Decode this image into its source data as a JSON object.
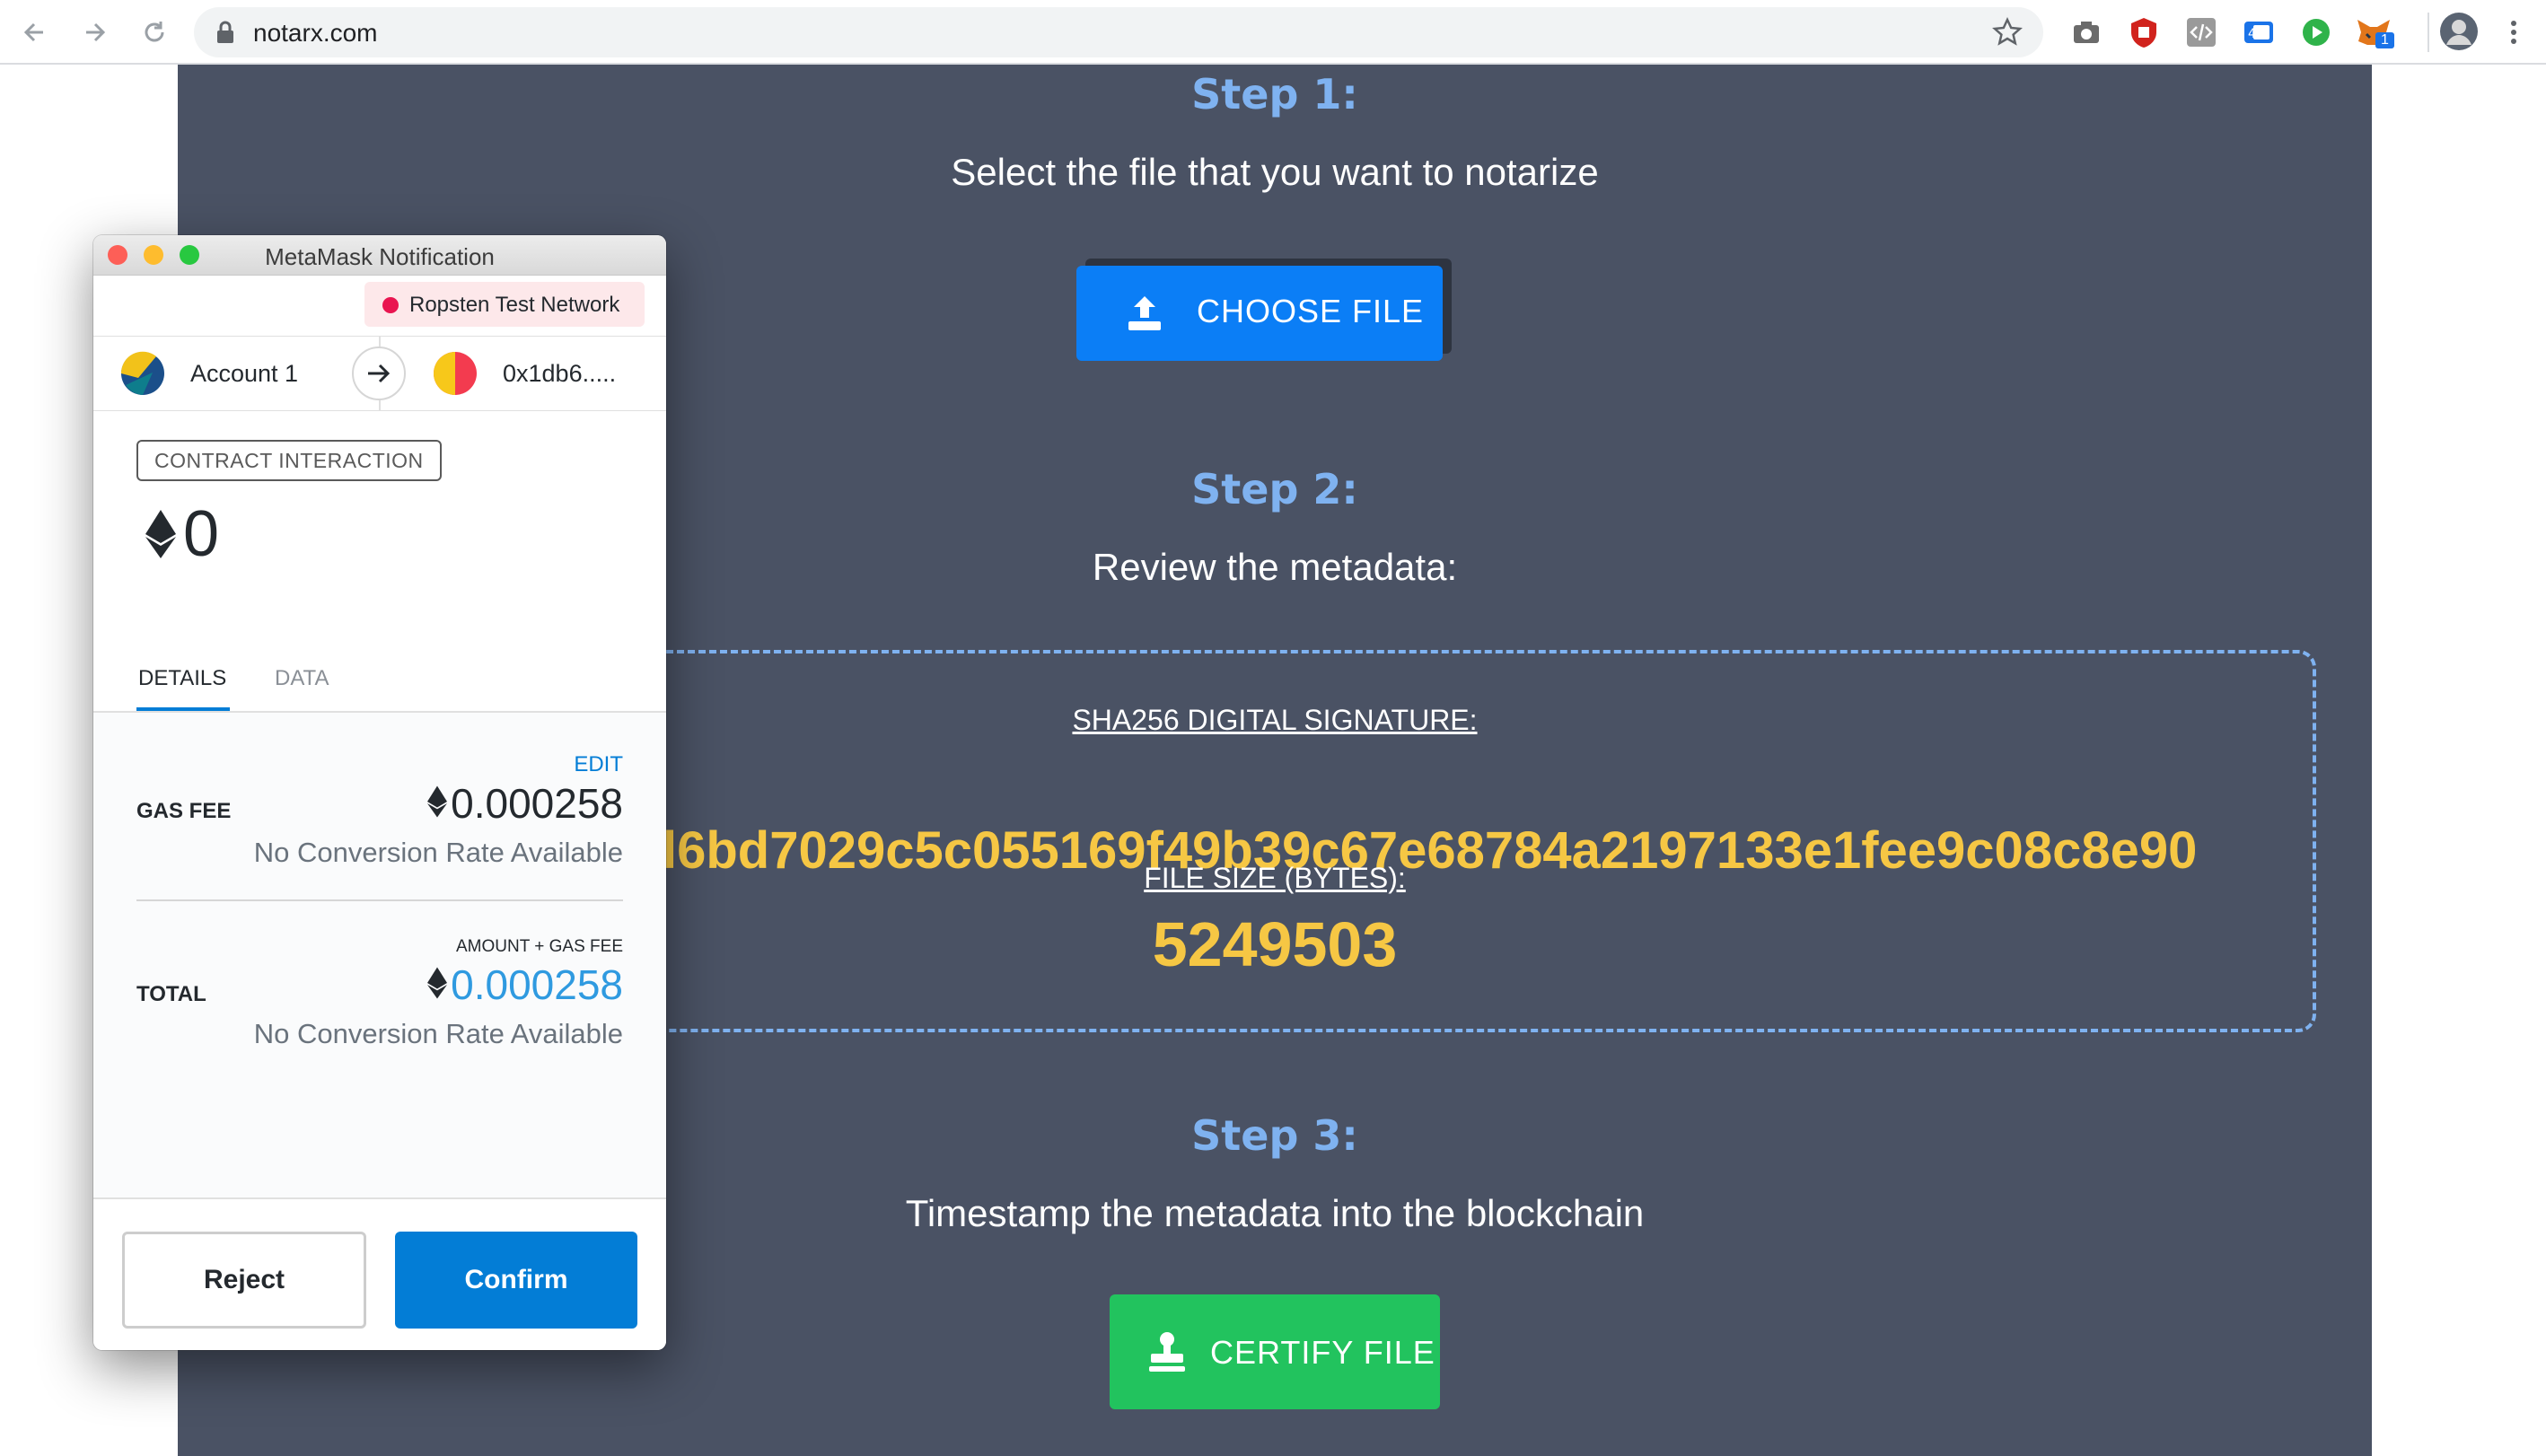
{
  "browser": {
    "url": "notarx.com",
    "extension_badge": "1"
  },
  "page": {
    "step1": {
      "title": "Step 1:",
      "subtitle": "Select the file that you want to notarize",
      "button": "CHOOSE FILE"
    },
    "step2": {
      "title": "Step 2:",
      "subtitle": "Review the metadata:",
      "sha_label": "SHA256 DIGITAL SIGNATURE:",
      "sha_value": "l6bd7029c5c055169f49b39c67e68784a2197133e1fee9c08c8e90",
      "size_label": "FILE SIZE (BYTES):",
      "size_value": "5249503"
    },
    "step3": {
      "title": "Step 3:",
      "subtitle": "Timestamp the metadata into the blockchain",
      "button": "CERTIFY FILE"
    }
  },
  "metamask": {
    "window_title": "MetaMask Notification",
    "network": "Ropsten Test Network",
    "from_account": "Account 1",
    "to_address": "0x1db6.....",
    "tx_type": "CONTRACT INTERACTION",
    "amount": "0",
    "tabs": [
      "DETAILS",
      "DATA"
    ],
    "edit_label": "EDIT",
    "gas_fee_label": "GAS FEE",
    "gas_fee_value": "0.000258",
    "gas_fee_conversion": "No Conversion Rate Available",
    "total_caption": "AMOUNT + GAS FEE",
    "total_label": "TOTAL",
    "total_value": "0.000258",
    "total_conversion": "No Conversion Rate Available",
    "reject_label": "Reject",
    "confirm_label": "Confirm"
  },
  "colors": {
    "page_bg": "#4a5264",
    "step_title": "#7fb2f0",
    "hash_yellow": "#f6c744",
    "choose_blue": "#0b7ef6",
    "certify_green": "#22c35e",
    "confirm_blue": "#037dd6"
  }
}
